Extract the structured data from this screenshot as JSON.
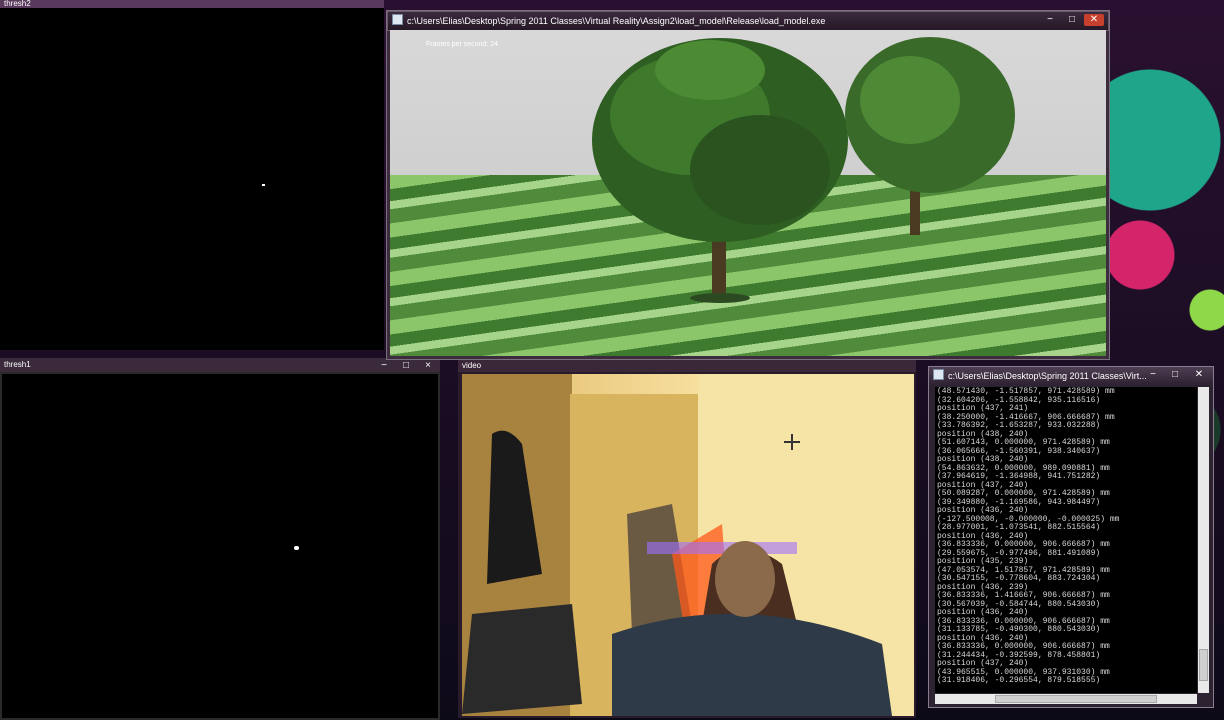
{
  "windows": {
    "thresh2": {
      "title": "thresh2"
    },
    "thresh1": {
      "title": "thresh1",
      "controls": [
        "−",
        "□",
        "×"
      ]
    },
    "viewer": {
      "title": "c:\\Users\\Elias\\Desktop\\Spring 2011 Classes\\Virtual Reality\\Assign2\\load_model\\Release\\load_model.exe",
      "fps_text": "Frames per second: 24",
      "controls": [
        "−",
        "□",
        "✕"
      ]
    },
    "video": {
      "title": "video"
    },
    "console": {
      "title": "c:\\Users\\Elias\\Desktop\\Spring 2011 Classes\\Virt...",
      "controls": [
        "−",
        "□",
        "✕"
      ],
      "lines": [
        "(48.571430, -1.517857, 971.428589) mm",
        "(32.604206, -1.558842, 935.116516)",
        "position (437, 241)",
        "(38.250000, -1.416667, 906.666687) mm",
        "(33.786392, -1.653287, 933.032288)",
        "position (438, 240)",
        "(51.607143, 0.000000, 971.428589) mm",
        "(36.065666, -1.560391, 938.340637)",
        "position (438, 240)",
        "(54.863632, 0.000000, 989.090881) mm",
        "(37.964619, -1.364988, 941.751282)",
        "position (437, 240)",
        "(50.089287, 0.000000, 971.428589) mm",
        "(39.349880, -1.169586, 943.984497)",
        "position (436, 240)",
        "(-127.500008, -0.000000, -0.000025) mm",
        "(28.977001, -1.073541, 882.515564)",
        "position (436, 240)",
        "(36.833336, 0.000000, 906.666687) mm",
        "(29.559675, -0.977496, 881.491089)",
        "position (435, 239)",
        "(47.053574, 1.517857, 971.428589) mm",
        "(30.547155, -0.778604, 883.724304)",
        "position (436, 239)",
        "(36.833336, 1.416667, 906.666687) mm",
        "(30.567039, -0.584744, 880.543030)",
        "position (436, 240)",
        "(36.833336, 0.000000, 906.666687) mm",
        "(31.133785, -0.490300, 880.543030)",
        "position (436, 240)",
        "(36.833336, 0.000000, 906.666687) mm",
        "(31.244434, -0.392599, 878.458801)",
        "position (437, 240)",
        "(43.965515, 0.000000, 937.931030) mm",
        "(31.918406, -0.296554, 879.518555)"
      ]
    }
  },
  "colors": {
    "close": "#c7402d",
    "console_bg": "#000000",
    "console_text": "#d8d8d8"
  }
}
